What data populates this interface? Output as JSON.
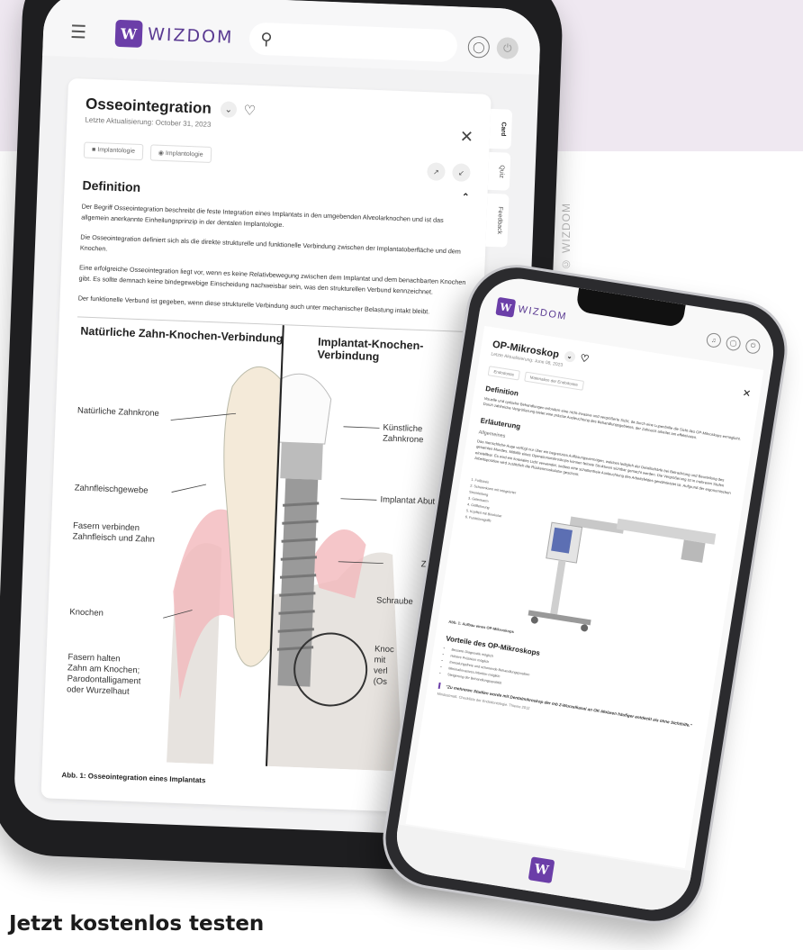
{
  "watermark": "© WIZDOM",
  "cta": "Jetzt kostenlos testen",
  "tablet": {
    "brand": "WIZDOM",
    "logo_letter": "W",
    "card": {
      "title": "Osseointegration",
      "updated": "Letzte Aktualisierung: October 31, 2023",
      "tags": [
        "Implantologie",
        "Implantologie"
      ],
      "side_tabs": [
        "Card",
        "Quiz",
        "Feedback"
      ],
      "section_title": "Definition",
      "paragraphs": [
        "Der Begriff Osseointegration beschreibt die feste Integration eines Implantats in den umgebenden Alveolarknochen und ist das allgemein anerkannte Einheilungsprinzip in der dentalen Implantologie.",
        "Die Osseointegration definiert sich als die direkte strukturelle und funktionelle Verbindung zwischen der Implantatoberfläche und dem Knochen.",
        "Eine erfolgreiche Osseointegration liegt vor, wenn es keine Relativbewegung zwischen dem Implantat und dem benachbarten Knochen gibt. Es sollte demnach keine bindegewebige Einscheidung nachweisbar sein, was den strukturellen Verbund kennzeichnet.",
        "Der funktionelle Verbund ist gegeben, wenn diese strukturelle Verbindung auch unter mechanischer Belastung intakt bleibt."
      ],
      "figure": {
        "left_title": "Natürliche Zahn-Knochen-Verbindung",
        "right_title": "Implantat-Knochen-Verbindung",
        "labels_left": [
          "Natürliche Zahnkrone",
          "Zahnfleischgewebe",
          "Fasern verbinden\nZahnfleisch und Zahn",
          "Knochen",
          "Fasern halten\nZahn am Knochen;\nParodontalligament\noder Wurzelhaut"
        ],
        "labels_right": [
          "Künstliche Zahnkrone",
          "Implantat Abut",
          "Zal",
          "Schraube",
          "Knoc\nmit\nverl\n(Os"
        ],
        "caption": "Abb. 1: Osseointegration eines Implantats"
      }
    }
  },
  "phone": {
    "brand": "WIZDOM",
    "logo_letter": "W",
    "card": {
      "title": "OP-Mikroskop",
      "updated": "Letzte Aktualisierung: June 08, 2023",
      "tags": [
        "Endodontie",
        "Materialien der Endodontie"
      ],
      "section1": "Definition",
      "text1": "Visuelle und optische Behandlungen erfordern eine nicht-invasive und vergrößerte Sicht, da durch eine Lupenbrille die Sicht des OP-Mikroskops ermöglicht. Durch zahlreiche Vergrößerung bietet eine präzise Ausleuchtung des Behandlungsgebietes, der Zahnarzt arbeitet am effektivsten.",
      "section2": "Erläuterung",
      "sub": "Allgemeines",
      "text2": "Das menschliche Auge verfügt nur über ein begrenztes Auflösungsvermögen, welches lediglich der Detailschärfe bei Betrachtung und Beurteilung des gesamten Mundes. Mithilfe eines Operationsmikroskops können feinste Strukturen sichtbar gemacht werden. Die Vergrößerung ist in mehreren Stufen einstellbar. Es wird ein koaxiales Licht verwendet, sodass eine schattenfreie Ausleuchtung des Arbeitsfeldes gewährleistet ist. Aufgrund der ergonomischen Arbeitsposition wird zusätzlich die Rückenmuskulatur geschont.",
      "list": [
        "1. Fußbasis",
        "2. Schwenkarm mit integrierter Stromleitung",
        "3. Gelenkarm",
        "4. Grifflehnung",
        "5. Kopfteil mit Binokular",
        "6. Funktionsgriffe"
      ],
      "figure_caption": "Abb. 1: Aufbau eines OP-Mikroskops",
      "section3": "Vorteile des OP-Mikroskops",
      "advantages": [
        "Bessere Diagnostik möglich",
        "Höhere Präzision möglich",
        "Ermüdungsfreie und schonende Behandlungsposition",
        "Minimalinvasives Arbeiten möglich",
        "Steigerung der Behandlungsqualität"
      ],
      "quote": "\"Zu mehreren Studien wurde mit Dentalmikroskop der mb 2-Wurzelkanal an OK-Molaren häufiger entdeckt als ohne Sichthilfe.\"",
      "quote_source": "Mindestmaß. Checkliste der Endodontologie. Thieme 2012"
    }
  }
}
